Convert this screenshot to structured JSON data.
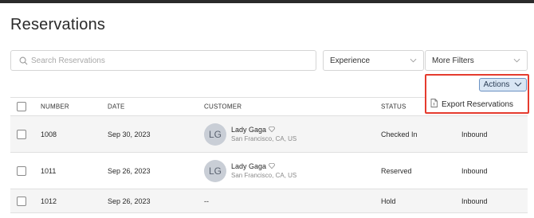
{
  "page": {
    "title": "Reservations"
  },
  "search": {
    "placeholder": "Search Reservations"
  },
  "filters": {
    "experience_label": "Experience",
    "more_filters_label": "More Filters"
  },
  "actions": {
    "button_label": "Actions",
    "menu": [
      {
        "label": "Export Reservations",
        "icon": "document-icon"
      }
    ]
  },
  "table": {
    "headers": [
      "NUMBER",
      "DATE",
      "CUSTOMER",
      "STATUS"
    ],
    "rows": [
      {
        "number": "1008",
        "date": "Sep 30, 2023",
        "customer_initials": "LG",
        "customer_name": "Lady Gaga",
        "customer_location": "San Francisco, CA, US",
        "status": "Checked In",
        "direction": "Inbound"
      },
      {
        "number": "1011",
        "date": "Sep 26, 2023",
        "customer_initials": "LG",
        "customer_name": "Lady Gaga",
        "customer_location": "San Francisco, CA, US",
        "status": "Reserved",
        "direction": "Inbound"
      },
      {
        "number": "1012",
        "date": "Sep 26, 2023",
        "customer_empty": "--",
        "status": "Hold",
        "direction": "Inbound"
      }
    ]
  },
  "colors": {
    "highlight": "#e53b2e",
    "actions_bg": "#d9e6f4",
    "actions_border": "#6d93c4"
  }
}
